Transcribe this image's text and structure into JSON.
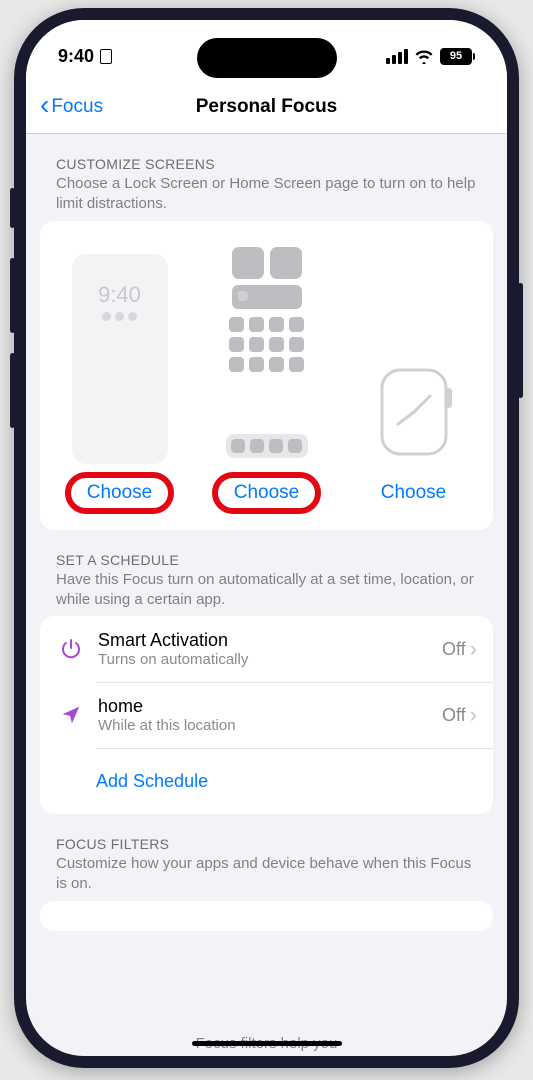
{
  "status": {
    "time": "9:40",
    "battery": "95"
  },
  "nav": {
    "back": "Focus",
    "title": "Personal Focus"
  },
  "customize": {
    "title": "CUSTOMIZE SCREENS",
    "desc": "Choose a Lock Screen or Home Screen page to turn on to help limit distractions.",
    "lock_preview_time": "9:40",
    "choose_lock": "Choose",
    "choose_home": "Choose",
    "choose_watch": "Choose"
  },
  "schedule": {
    "title": "SET A SCHEDULE",
    "desc": "Have this Focus turn on automatically at a set time, location, or while using a certain app.",
    "rows": [
      {
        "title": "Smart Activation",
        "sub": "Turns on automatically",
        "value": "Off"
      },
      {
        "title": "home",
        "sub": "While at this location",
        "value": "Off"
      }
    ],
    "add": "Add Schedule"
  },
  "filters": {
    "title": "FOCUS FILTERS",
    "desc": "Customize how your apps and device behave when this Focus is on.",
    "peek": "Focus filters help you"
  }
}
